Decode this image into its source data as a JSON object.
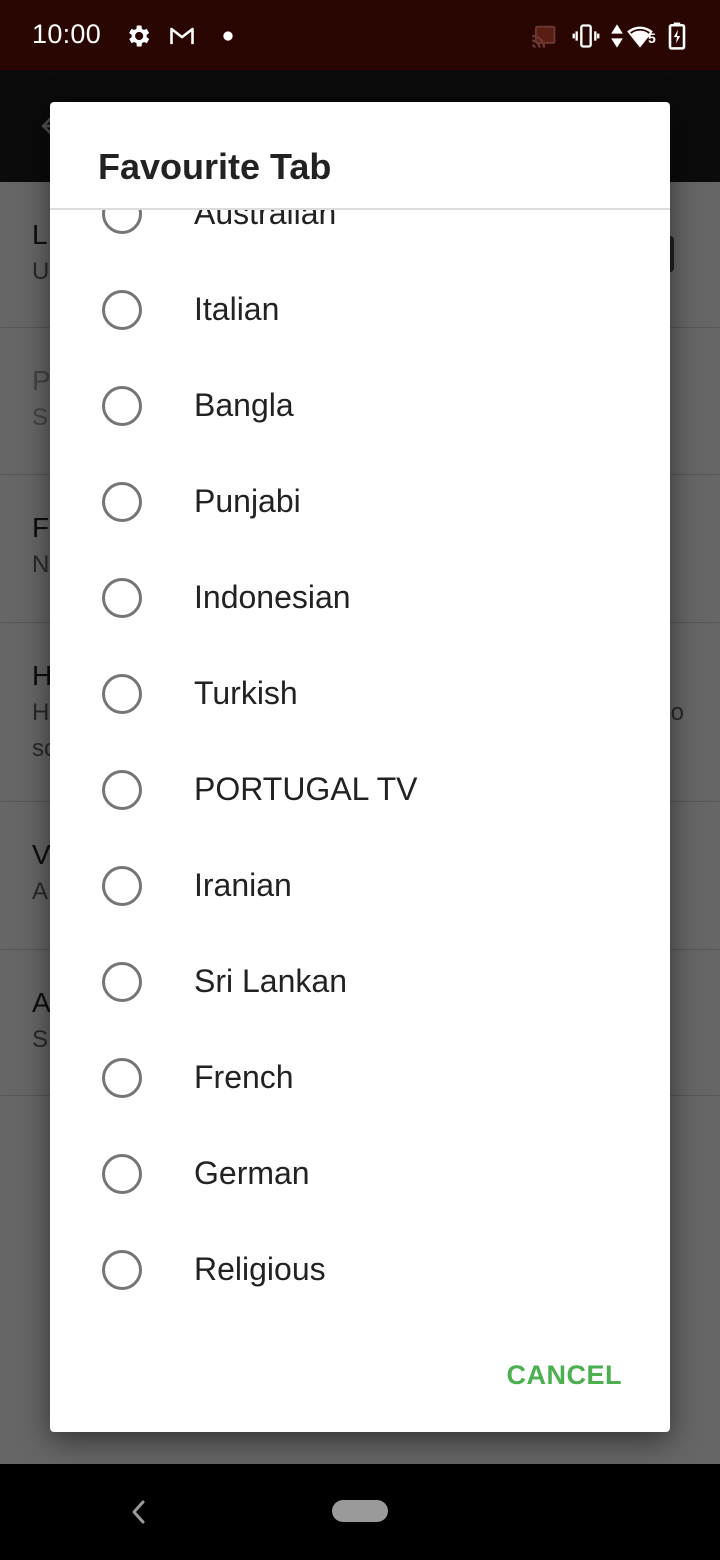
{
  "status_bar": {
    "time": "10:00",
    "left_icons": [
      "settings-gear-icon",
      "gmail-icon",
      "notification-dot-icon"
    ],
    "right_icons": [
      "cast-icon",
      "vibrate-icon",
      "data-activity-icon",
      "wifi-icon",
      "battery-charging-icon"
    ],
    "wifi_badge": "5"
  },
  "background_screen": {
    "app_bar": {
      "back_icon": "back-arrow-icon"
    },
    "preferences": [
      {
        "title_initial": "L",
        "summary_initial": "U",
        "has_switch": true,
        "enabled": true
      },
      {
        "title_initial": "P",
        "summary_initial": "S",
        "has_switch": false,
        "enabled": false
      },
      {
        "title_initial": "F",
        "summary_initial": "N",
        "has_switch": false,
        "enabled": true
      },
      {
        "title_initial": "H",
        "summary_initial": "H",
        "summary_line2_initial": "sc",
        "trailing_char": "o",
        "has_switch": false,
        "enabled": true
      },
      {
        "title_initial": "V",
        "summary_initial": "A",
        "has_switch": false,
        "enabled": true
      },
      {
        "title_initial": "A",
        "summary_initial": "S",
        "has_switch": false,
        "enabled": true
      }
    ]
  },
  "dialog": {
    "title": "Favourite Tab",
    "options": [
      {
        "label": "Australian",
        "selected": false
      },
      {
        "label": "Italian",
        "selected": false
      },
      {
        "label": "Bangla",
        "selected": false
      },
      {
        "label": "Punjabi",
        "selected": false
      },
      {
        "label": "Indonesian",
        "selected": false
      },
      {
        "label": "Turkish",
        "selected": false
      },
      {
        "label": "PORTUGAL TV",
        "selected": false
      },
      {
        "label": "Iranian",
        "selected": false
      },
      {
        "label": "Sri Lankan",
        "selected": false
      },
      {
        "label": "French",
        "selected": false
      },
      {
        "label": "German",
        "selected": false
      },
      {
        "label": "Religious",
        "selected": false
      }
    ],
    "cancel_label": "CANCEL",
    "accent_color": "#4caf50"
  },
  "nav_bar": {
    "back_icon": "nav-back-icon",
    "home_icon": "nav-home-pill-icon"
  }
}
